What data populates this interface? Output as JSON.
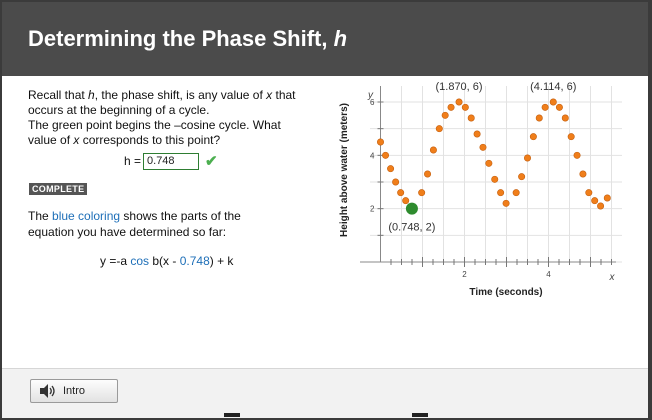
{
  "header": {
    "title_prefix": "Determining the Phase Shift, ",
    "title_var": "h"
  },
  "prompt": {
    "l1_a": "Recall that ",
    "l1_h": "h",
    "l1_b": ", the phase shift, is any value of ",
    "l1_x": "x",
    "l1_c": " that",
    "l2": "occurs at the beginning of a cycle.",
    "l3": "The green point begins the –cosine cycle. What",
    "l4_a": "value of ",
    "l4_x": "x",
    "l4_b": " corresponds to this point?"
  },
  "answer": {
    "label": "h = ",
    "value": "0.748",
    "status_icon": "checkmark"
  },
  "badge": "COMPLETE",
  "description": {
    "a": "The ",
    "blue": "blue coloring",
    "b": " shows the parts of the equation you have determined so far:"
  },
  "equation": {
    "p1": "y =-a ",
    "cos": "cos",
    "p2": " b(x - ",
    "h": "0.748",
    "p3": ") + k"
  },
  "footer": {
    "intro_label": "Intro",
    "intro_icon": "speaker-icon"
  },
  "colors": {
    "point": "#f07e1a",
    "start_point": "#2e8b2e",
    "accent": "#1e6fb8",
    "header": "#4b4b4b"
  },
  "chart_data": {
    "type": "scatter",
    "xlabel": "Time (seconds)",
    "ylabel": "Height above water (meters)",
    "x_axis_var": "x",
    "y_axis_var": "y",
    "xlim": [
      -0.25,
      5.75
    ],
    "ylim": [
      -0.6,
      6.6
    ],
    "x_ticks": [
      2,
      4
    ],
    "y_ticks": [
      2,
      4,
      6
    ],
    "annotations": [
      {
        "text": "(1.870, 6)",
        "x": 1.87,
        "y": 6
      },
      {
        "text": "(4.114, 6)",
        "x": 4.114,
        "y": 6
      },
      {
        "text": "(0.748, 2)",
        "x": 0.748,
        "y": 2
      }
    ],
    "highlight_point": {
      "x": 0.748,
      "y": 2
    },
    "series": [
      {
        "x": [
          0.0,
          0.12,
          0.24,
          0.36,
          0.48,
          0.6,
          0.98,
          1.12,
          1.26,
          1.4,
          1.54,
          1.68,
          1.87,
          2.02,
          2.16,
          2.3,
          2.44,
          2.58,
          2.72,
          2.86,
          2.99,
          3.23,
          3.36,
          3.5,
          3.64,
          3.78,
          3.92,
          4.114,
          4.26,
          4.4,
          4.54,
          4.68,
          4.82,
          4.96,
          5.1,
          5.24,
          5.4
        ],
        "y": [
          4.5,
          4.0,
          3.5,
          3.0,
          2.6,
          2.3,
          2.6,
          3.3,
          4.2,
          5.0,
          5.5,
          5.8,
          6.0,
          5.8,
          5.4,
          4.8,
          4.3,
          3.7,
          3.1,
          2.6,
          2.2,
          2.6,
          3.2,
          3.9,
          4.7,
          5.4,
          5.8,
          6.0,
          5.8,
          5.4,
          4.7,
          4.0,
          3.3,
          2.6,
          2.3,
          2.1,
          2.4
        ]
      }
    ]
  }
}
